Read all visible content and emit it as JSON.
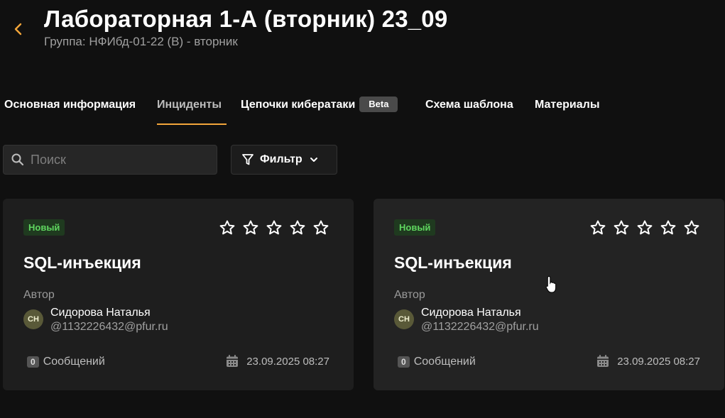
{
  "header": {
    "title": "Лабораторная 1-А (вторник) 23_09",
    "subtitle": "Группа: НФИбд-01-22 (В) - вторник"
  },
  "tabs": [
    {
      "label": "Основная информация",
      "active": false
    },
    {
      "label": "Инциденты",
      "active": true
    },
    {
      "label": "Цепочки кибератаки",
      "active": false,
      "badge": "Beta"
    },
    {
      "label": "Схема шаблона",
      "active": false
    },
    {
      "label": "Материалы",
      "active": false
    }
  ],
  "search": {
    "placeholder": "Поиск",
    "value": ""
  },
  "filter": {
    "label": "Фильтр"
  },
  "cards": [
    {
      "status": "Новый",
      "title": "SQL-инъекция",
      "author_label": "Автор",
      "author_initials": "СН",
      "author_name": "Сидорова Наталья",
      "author_email": "@1132226432@pfur.ru",
      "messages_count": "0",
      "messages_label": "Сообщений",
      "date": "23.09.2025 08:27",
      "rating": 0
    },
    {
      "status": "Новый",
      "title": "SQL-инъекция",
      "author_label": "Автор",
      "author_initials": "СН",
      "author_name": "Сидорова Наталья",
      "author_email": "@1132226432@pfur.ru",
      "messages_count": "0",
      "messages_label": "Сообщений",
      "date": "23.09.2025 08:27",
      "rating": 0
    }
  ],
  "colors": {
    "accent": "#f2a53a",
    "status_new": "#5fd65f",
    "background": "#101010",
    "card": "#1e1e1e"
  },
  "icons": [
    "chevron-left-icon",
    "search-icon",
    "filter-icon",
    "chevron-down-icon",
    "star-outline-icon",
    "calendar-icon",
    "pointer-cursor-icon"
  ]
}
